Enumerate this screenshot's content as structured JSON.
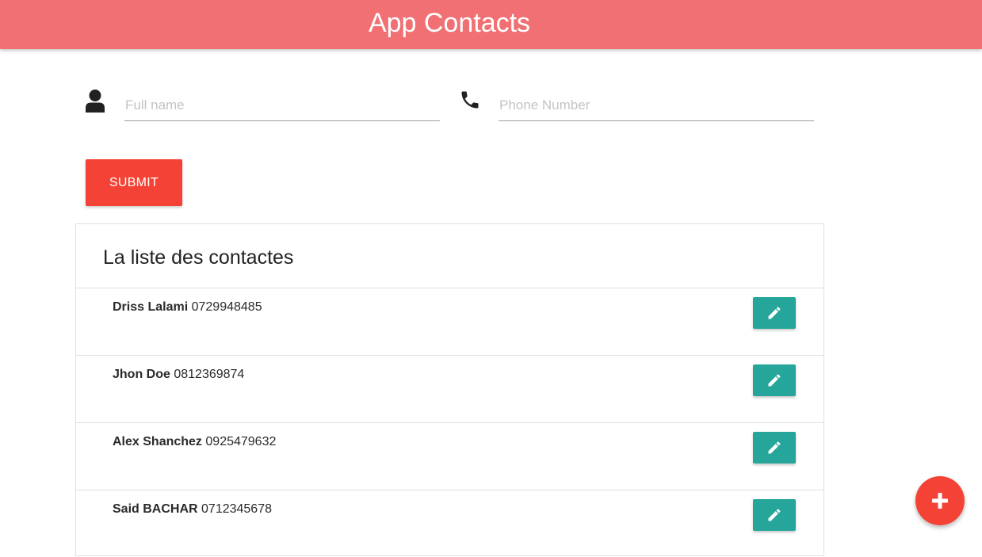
{
  "navbar": {
    "title": "App Contacts",
    "color": "#f07074"
  },
  "form": {
    "name_icon": "person-icon",
    "name_placeholder": "Full name",
    "name_value": "",
    "phone_icon": "phone-icon",
    "phone_placeholder": "Phone Number",
    "phone_value": "",
    "submit_label": "SUBMIT",
    "submit_color": "#f44336"
  },
  "contacts": {
    "title": "La liste des contactes",
    "edit_icon": "pencil-icon",
    "edit_color": "#26a69a",
    "items": [
      {
        "name": "Driss Lalami",
        "phone": "0729948485"
      },
      {
        "name": "Jhon Doe",
        "phone": "0812369874"
      },
      {
        "name": "Alex Shanchez",
        "phone": "0925479632"
      },
      {
        "name": "Said BACHAR",
        "phone": "0712345678"
      }
    ]
  },
  "fab": {
    "icon": "plus-icon",
    "color": "#f44336"
  }
}
